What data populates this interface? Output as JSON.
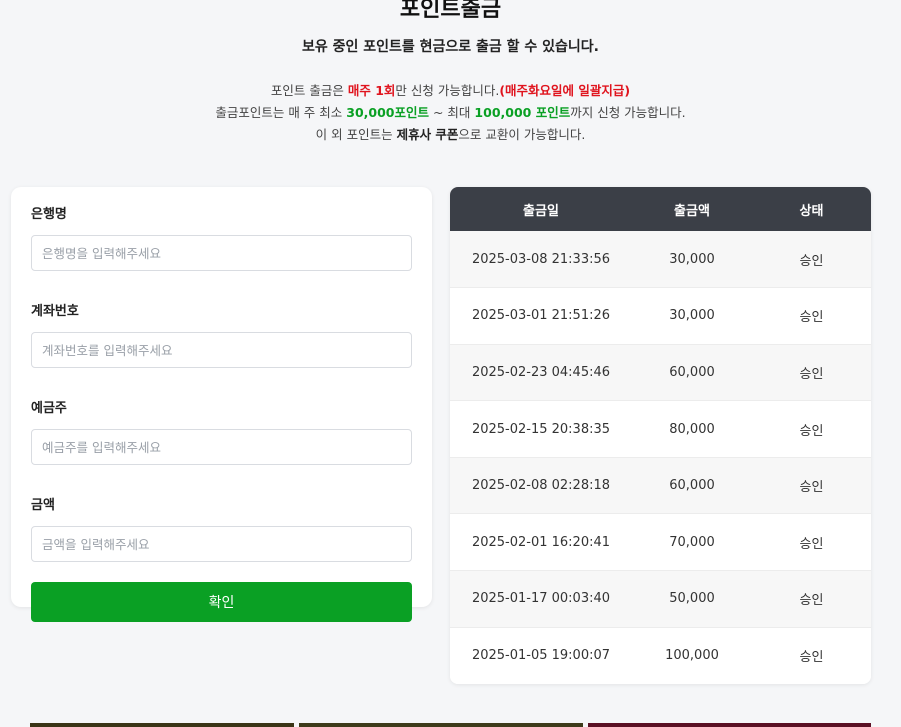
{
  "header": {
    "title": "포인트출금",
    "subtitle": "보유 중인 포인트를 현금으로 출금 할 수 있습니다."
  },
  "notice": {
    "line1": {
      "a": "포인트 출금은 ",
      "b": "매주 1회",
      "c": "만 신청 가능합니다.",
      "d": "(매주화요일에 일괄지급)"
    },
    "line2": {
      "a": "출금포인트는 매 주 최소 ",
      "b": "30,000포인트",
      "c": " ~ 최대 ",
      "d": "100,000 포인트",
      "e": "까지 신청 가능합니다."
    },
    "line3": {
      "a": "이 외 포인트는 ",
      "b": "제휴사 쿠폰",
      "c": "으로 교환이 가능합니다."
    }
  },
  "form": {
    "fields": [
      {
        "label": "은행명",
        "placeholder": "은행명을 입력해주세요",
        "value": ""
      },
      {
        "label": "계좌번호",
        "placeholder": "계좌번호를 입력해주세요",
        "value": ""
      },
      {
        "label": "예금주",
        "placeholder": "예금주를 입력해주세요",
        "value": ""
      },
      {
        "label": "금액",
        "placeholder": "금액을 입력해주세요",
        "value": ""
      }
    ],
    "submit_label": "확인"
  },
  "history": {
    "columns": [
      "출금일",
      "출금액",
      "상태"
    ],
    "rows": [
      {
        "date": "2025-03-08 21:33:56",
        "amount": "30,000",
        "status": "승인"
      },
      {
        "date": "2025-03-01 21:51:26",
        "amount": "30,000",
        "status": "승인"
      },
      {
        "date": "2025-02-23 04:45:46",
        "amount": "60,000",
        "status": "승인"
      },
      {
        "date": "2025-02-15 20:38:35",
        "amount": "80,000",
        "status": "승인"
      },
      {
        "date": "2025-02-08 02:28:18",
        "amount": "60,000",
        "status": "승인"
      },
      {
        "date": "2025-02-01 16:20:41",
        "amount": "70,000",
        "status": "승인"
      },
      {
        "date": "2025-01-17 00:03:40",
        "amount": "50,000",
        "status": "승인"
      },
      {
        "date": "2025-01-05 19:00:07",
        "amount": "100,000",
        "status": "승인"
      }
    ]
  },
  "colors": {
    "accent_green": "#0aa024",
    "accent_red": "#e0141e",
    "table_header": "#3b3f47"
  }
}
